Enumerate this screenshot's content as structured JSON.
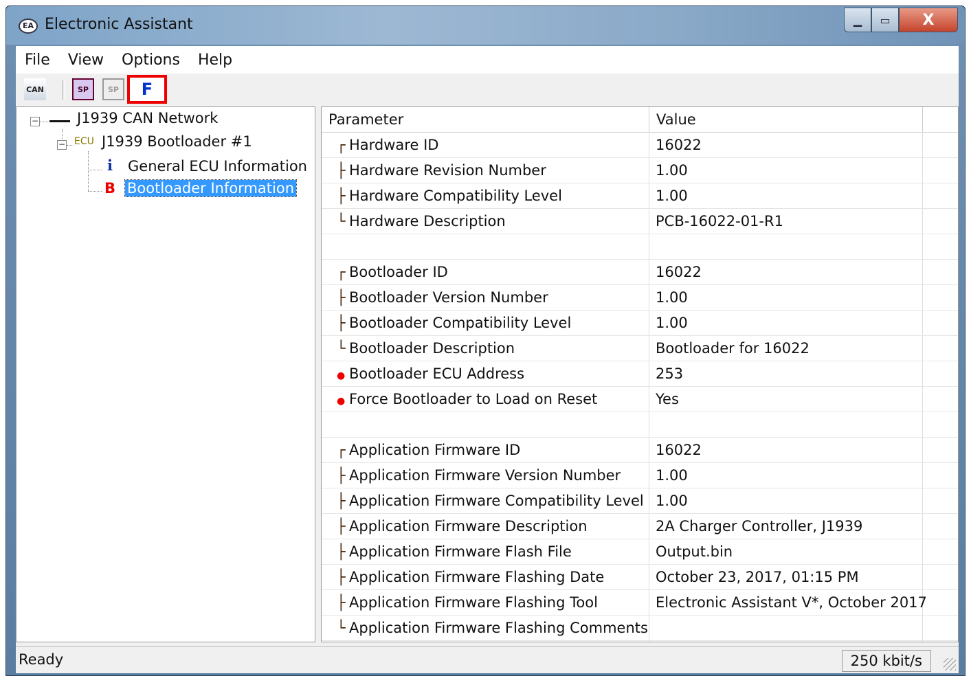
{
  "window": {
    "title": "Electronic Assistant"
  },
  "menu": [
    "File",
    "View",
    "Options",
    "Help"
  ],
  "toolbar": {
    "can_label": "CAN",
    "sp_label": "SP",
    "sp2_label": "SP",
    "flash_label": "F"
  },
  "tree": {
    "network": "J1939 CAN Network",
    "ecu_tag": "ECU",
    "ecu": "J1939 Bootloader #1",
    "info_icon": "i",
    "info": "General ECU Information",
    "boot_icon": "B",
    "boot": "Bootloader Information"
  },
  "table": {
    "headers": {
      "parameter": "Parameter",
      "value": "Value"
    },
    "rows": [
      {
        "marker": "┌",
        "param": "Hardware ID",
        "value": "16022"
      },
      {
        "marker": "├",
        "param": "Hardware Revision Number",
        "value": "1.00"
      },
      {
        "marker": "├",
        "param": "Hardware Compatibility Level",
        "value": "1.00"
      },
      {
        "marker": "└",
        "param": "Hardware Description",
        "value": "PCB-16022-01-R1"
      },
      {
        "marker": "",
        "param": "",
        "value": ""
      },
      {
        "marker": "┌",
        "param": "Bootloader ID",
        "value": "16022"
      },
      {
        "marker": "├",
        "param": "Bootloader Version Number",
        "value": "1.00"
      },
      {
        "marker": "├",
        "param": "Bootloader Compatibility Level",
        "value": "1.00"
      },
      {
        "marker": "└",
        "param": "Bootloader Description",
        "value": "Bootloader for 16022"
      },
      {
        "marker": "●",
        "param": "Bootloader ECU Address",
        "value": "253"
      },
      {
        "marker": "●",
        "param": "Force Bootloader to Load on Reset",
        "value": "Yes"
      },
      {
        "marker": "",
        "param": "",
        "value": ""
      },
      {
        "marker": "┌",
        "param": "Application Firmware ID",
        "value": "16022"
      },
      {
        "marker": "├",
        "param": "Application Firmware Version Number",
        "value": "1.00"
      },
      {
        "marker": "├",
        "param": "Application Firmware Compatibility Level",
        "value": "1.00"
      },
      {
        "marker": "├",
        "param": "Application Firmware Description",
        "value": "2A Charger Controller, J1939"
      },
      {
        "marker": "├",
        "param": "Application Firmware Flash File",
        "value": "Output.bin"
      },
      {
        "marker": "├",
        "param": "Application Firmware Flashing Date",
        "value": "October 23, 2017, 01:15 PM"
      },
      {
        "marker": "├",
        "param": "Application Firmware Flashing Tool",
        "value": "Electronic Assistant V*, October 2017"
      },
      {
        "marker": "└",
        "param": "Application Firmware Flashing Comments",
        "value": ""
      }
    ]
  },
  "status": {
    "text": "Ready",
    "rate": "250 kbit/s"
  }
}
